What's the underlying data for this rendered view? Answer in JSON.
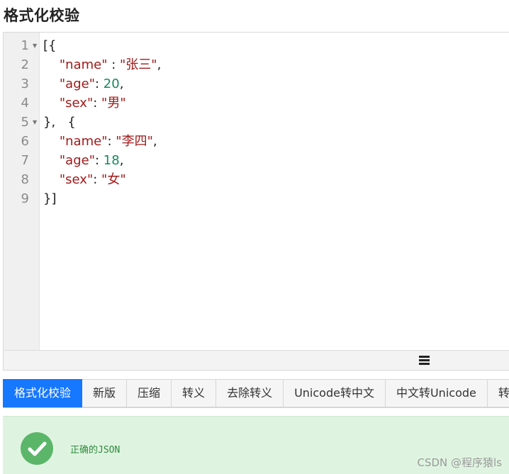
{
  "page": {
    "title": "格式化校验"
  },
  "editor": {
    "lines": [
      {
        "num": "1",
        "fold": true,
        "text": "[{"
      },
      {
        "num": "2",
        "fold": false,
        "key": "\"name\"",
        "sep": " : ",
        "val": "\"张三\"",
        "valtype": "str",
        "tail": ","
      },
      {
        "num": "3",
        "fold": false,
        "key": "\"age\"",
        "sep": ": ",
        "val": "20",
        "valtype": "num",
        "tail": ","
      },
      {
        "num": "4",
        "fold": false,
        "key": "\"sex\"",
        "sep": ": ",
        "val": "\"男\"",
        "valtype": "str",
        "tail": ""
      },
      {
        "num": "5",
        "fold": true,
        "text": "},   {"
      },
      {
        "num": "6",
        "fold": false,
        "key": "\"name\"",
        "sep": ": ",
        "val": "\"李四\"",
        "valtype": "str",
        "tail": ","
      },
      {
        "num": "7",
        "fold": false,
        "key": "\"age\"",
        "sep": ": ",
        "val": "18",
        "valtype": "num",
        "tail": ","
      },
      {
        "num": "8",
        "fold": false,
        "key": "\"sex\"",
        "sep": ": ",
        "val": "\"女\"",
        "valtype": "str",
        "tail": ""
      },
      {
        "num": "9",
        "fold": false,
        "text": "}]"
      }
    ],
    "footer_icon": "menu-icon"
  },
  "tabs": [
    {
      "label": "格式化校验",
      "active": true
    },
    {
      "label": "新版",
      "active": false
    },
    {
      "label": "压缩",
      "active": false
    },
    {
      "label": "转义",
      "active": false
    },
    {
      "label": "去除转义",
      "active": false
    },
    {
      "label": "Unicode转中文",
      "active": false
    },
    {
      "label": "中文转Unicode",
      "active": false
    },
    {
      "label": "转",
      "active": false
    }
  ],
  "result": {
    "icon": "check-icon",
    "message": "正确的JSON",
    "watermark": "CSDN @程序猿ls"
  },
  "colors": {
    "accent": "#1677ff",
    "success_bg": "#dff4e0",
    "success_icon": "#5bb66a",
    "json_key": "#a01a1a",
    "json_number": "#138a5a"
  }
}
